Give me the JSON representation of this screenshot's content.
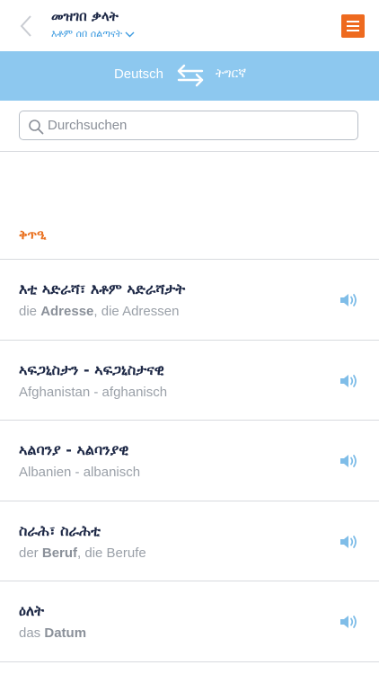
{
  "header": {
    "title": "መዝገበ ቃላት",
    "subtitle": "እቶም ሰበ ሰልጣናት",
    "back_icon": "chevron-left-icon",
    "menu_icon": "hamburger-menu-icon",
    "accent_color": "#ee6a1f"
  },
  "langbar": {
    "source": "Deutsch",
    "target": "ትግርኛ",
    "swap_icon": "swap-arrows-icon",
    "color": "#8dc8ef"
  },
  "search": {
    "placeholder": "Durchsuchen",
    "icon": "search-icon"
  },
  "section": {
    "title": "ቅጥዒ"
  },
  "entries": [
    {
      "term": "እቲ ኣድራሻ፣ እቶም ኣድራሻታት",
      "desc": [
        [
          "die ",
          false
        ],
        [
          "Adresse",
          true
        ],
        [
          ", die Adressen",
          false
        ]
      ]
    },
    {
      "term": "ኣፍጋኒስታን - ኣፍጋኒስታናዊ",
      "desc": [
        [
          "Afghanistan - afghanisch",
          false
        ]
      ]
    },
    {
      "term": "ኣልባንያ - ኣልባንያዊ",
      "desc": [
        [
          "Albanien - albanisch",
          false
        ]
      ]
    },
    {
      "term": "ስራሕ፣ ስራሕቲ",
      "desc": [
        [
          "der ",
          false
        ],
        [
          "Beruf",
          true
        ],
        [
          ", die Berufe",
          false
        ]
      ]
    },
    {
      "term": "ዕለት",
      "desc": [
        [
          "das ",
          false
        ],
        [
          "Datum",
          true
        ]
      ]
    }
  ]
}
